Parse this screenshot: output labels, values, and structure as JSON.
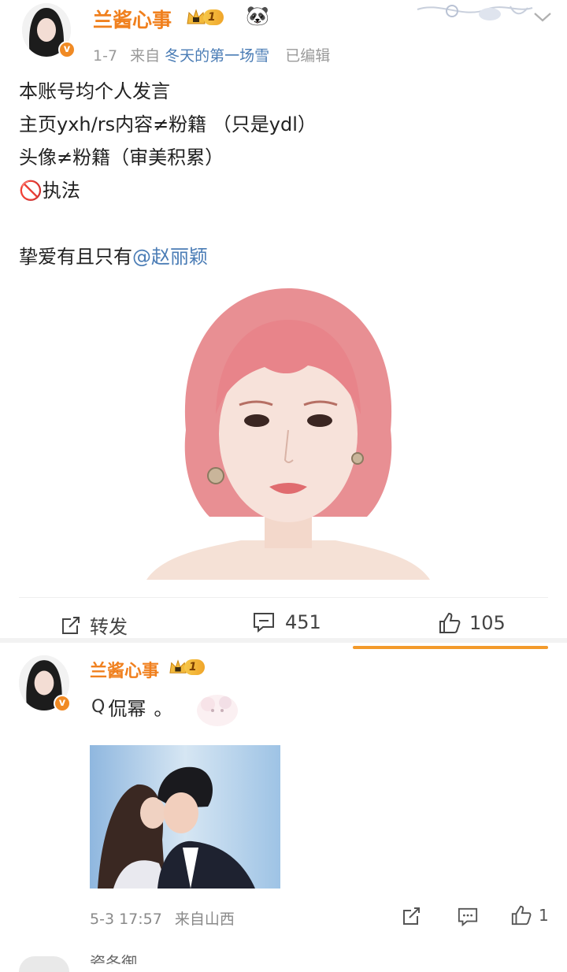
{
  "post1": {
    "username": "兰酱心事",
    "level_badge": "1",
    "emoji": "🐼",
    "verified_mark": "v",
    "date": "1-7",
    "from_prefix": "来自",
    "source": "冬天的第一场雪",
    "edited": "已编辑",
    "lines": [
      "本账号均个人发言",
      "主页yxh/rs内容≠粉籍 （只是ydl）",
      "头像≠粉籍（审美积累）",
      "🚫执法"
    ],
    "closing_prefix": "挚爱有且只有",
    "mention": "@赵丽颖",
    "actions": {
      "repost_label": "转发",
      "comments_count": "451",
      "likes_count": "105"
    }
  },
  "post2": {
    "username": "兰酱心事",
    "level_badge": "1",
    "verified_mark": "v",
    "search_icon_glyph": "Q",
    "comment_text": "侃幂",
    "comment_suffix": "。",
    "timestamp": "5-3 17:57",
    "location": "来自山西",
    "likes_count": "1"
  },
  "next_comment_partial": "瓷冬御",
  "colors": {
    "username": "#f0801e",
    "link": "#4a7cb5",
    "muted": "#9a9a9a",
    "verified": "#f08a24"
  }
}
